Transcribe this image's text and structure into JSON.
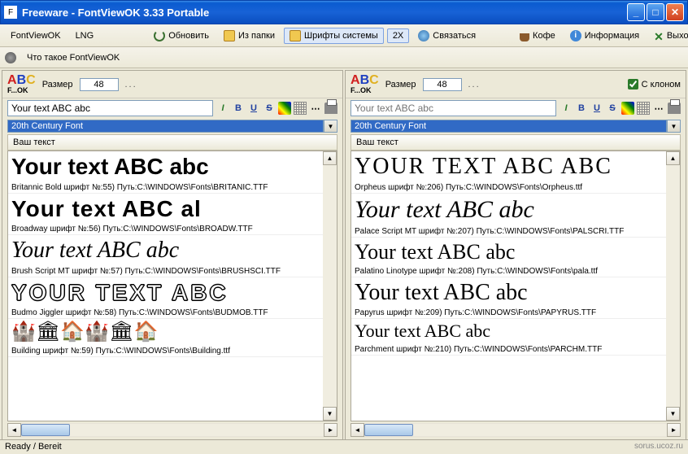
{
  "title": "Freeware - FontViewOK 3.33 Portable",
  "menu": {
    "app": "FontViewOK",
    "lng": "LNG"
  },
  "toolbar": {
    "refresh": "Обновить",
    "fromFolder": "Из папки",
    "systemFonts": "Шрифты системы",
    "zoom": "2X",
    "contact": "Связаться",
    "coffee": "Кофе",
    "info": "Информация",
    "exit": "Выход"
  },
  "whatIs": "Что такое FontViewOK",
  "pane": {
    "sizeLabel": "Размер",
    "sizeValue": "48",
    "dots": "...",
    "sampleText": "Your text ABC abc",
    "placeholder": "Your text ABC abc",
    "selectedFont": "20th Century Font",
    "colHeader": "Ваш текст",
    "cloneLabel": "С клоном"
  },
  "leftFonts": [
    {
      "sample": "Your text ABC abc",
      "cls": "f-britannic",
      "info": "Britannic Bold шрифт №:55) Путь:C:\\WINDOWS\\Fonts\\BRITANIC.TTF"
    },
    {
      "sample": "Your text ABC al",
      "cls": "f-broadway",
      "info": "Broadway шрифт №:56) Путь:C:\\WINDOWS\\Fonts\\BROADW.TTF"
    },
    {
      "sample": "Your text ABC abc",
      "cls": "f-brush",
      "info": "Brush Script MT шрифт №:57) Путь:C:\\WINDOWS\\Fonts\\BRUSHSCI.TTF"
    },
    {
      "sample": "YOUR TEXT ABC",
      "cls": "f-budmo",
      "info": "Budmo Jiggler шрифт №:58) Путь:C:\\WINDOWS\\Fonts\\BUDMOB.TTF"
    },
    {
      "sample": "🏰🏛🏠🏰🏛🏠",
      "cls": "f-building",
      "info": "Building шрифт №:59) Путь:C:\\WINDOWS\\Fonts\\Building.ttf"
    }
  ],
  "rightFonts": [
    {
      "sample": "YOUR TEXT ABC ABC",
      "cls": "f-orpheus",
      "info": "Orpheus шрифт №:206) Путь:C:\\WINDOWS\\Fonts\\Orpheus.ttf"
    },
    {
      "sample": "Your text ABC abc",
      "cls": "f-palace",
      "info": "Palace Script MT шрифт №:207) Путь:C:\\WINDOWS\\Fonts\\PALSCRI.TTF"
    },
    {
      "sample": "Your text ABC abc",
      "cls": "f-palatino",
      "info": "Palatino Linotype шрифт №:208) Путь:C:\\WINDOWS\\Fonts\\pala.ttf"
    },
    {
      "sample": "Your text ABC abc",
      "cls": "f-papyrus",
      "info": "Papyrus шрифт №:209) Путь:C:\\WINDOWS\\Fonts\\PAPYRUS.TTF"
    },
    {
      "sample": "Your text ABC abc",
      "cls": "f-parchment",
      "info": "Parchment шрифт №:210) Путь:C:\\WINDOWS\\Fonts\\PARCHM.TTF"
    }
  ],
  "status": "Ready / Bereit",
  "watermark": "sorus.ucoz.ru"
}
